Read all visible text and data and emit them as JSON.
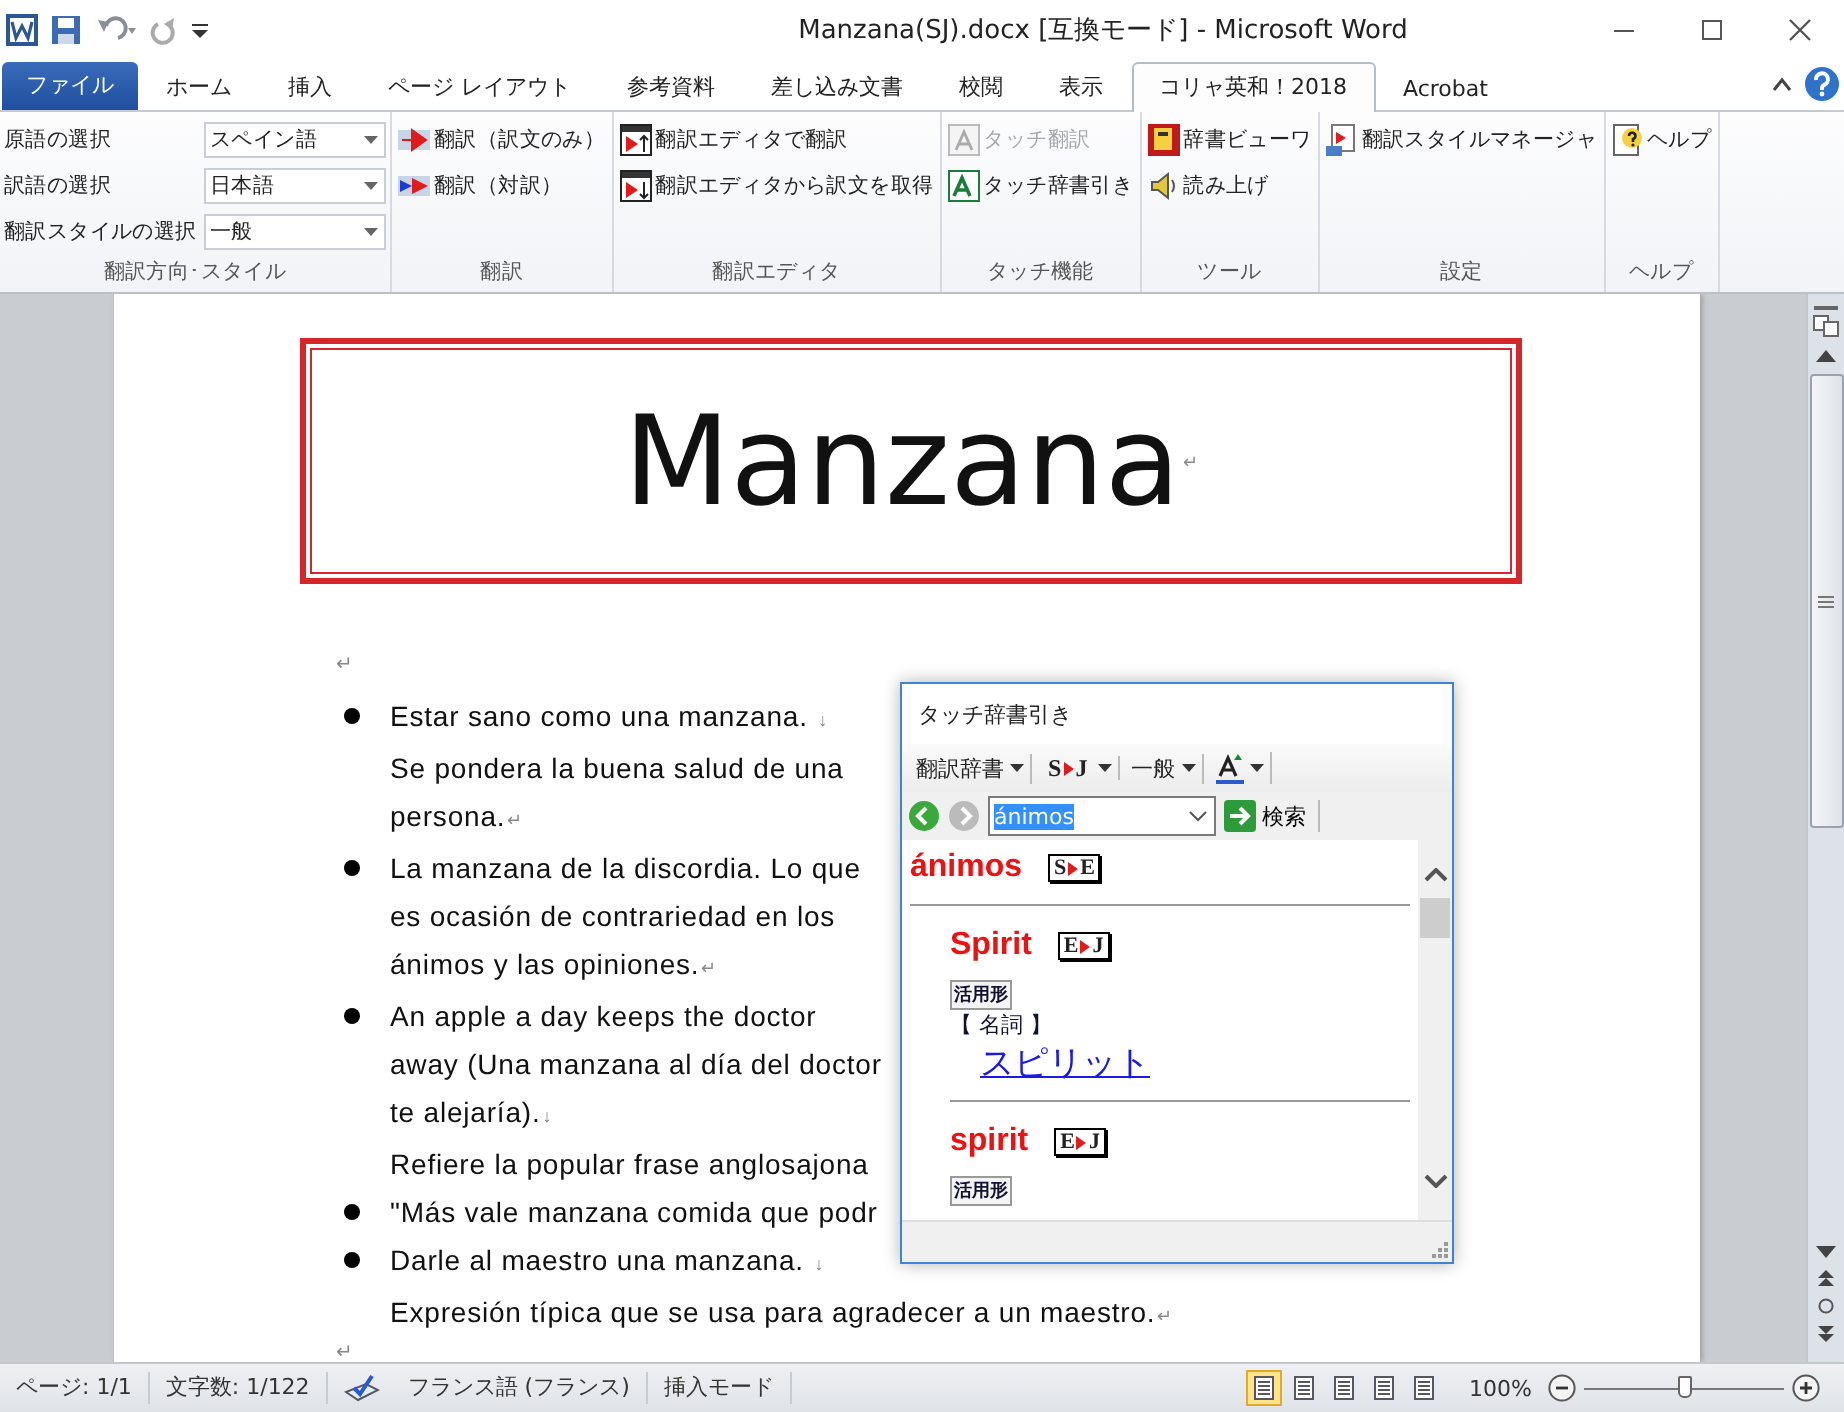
{
  "window": {
    "title": "Manzana(SJ).docx [互換モード] - Microsoft Word"
  },
  "tabs": [
    {
      "label": "ファイル",
      "kind": "file",
      "selected": false
    },
    {
      "label": "ホーム",
      "kind": "tab",
      "selected": false
    },
    {
      "label": "挿入",
      "kind": "tab",
      "selected": false
    },
    {
      "label": "ページ レイアウト",
      "kind": "tab",
      "selected": false
    },
    {
      "label": "参考資料",
      "kind": "tab",
      "selected": false
    },
    {
      "label": "差し込み文書",
      "kind": "tab",
      "selected": false
    },
    {
      "label": "校閲",
      "kind": "tab",
      "selected": false
    },
    {
      "label": "表示",
      "kind": "tab",
      "selected": false
    },
    {
      "label": "コリャ英和！2018",
      "kind": "tab",
      "selected": true
    },
    {
      "label": "Acrobat",
      "kind": "tab",
      "selected": false
    }
  ],
  "ribbon": {
    "groups": [
      {
        "label": "翻訳方向･スタイル",
        "kind": "selectors",
        "rows": [
          {
            "label": "原語の選択",
            "value": "スペイン語"
          },
          {
            "label": "訳語の選択",
            "value": "日本語"
          },
          {
            "label": "翻訳スタイルの選択",
            "value": "一般"
          }
        ]
      },
      {
        "label": "翻訳",
        "kind": "buttons",
        "buttons": [
          {
            "label": "翻訳（訳文のみ）",
            "disabled": false
          },
          {
            "label": "翻訳（対訳）",
            "disabled": false
          }
        ]
      },
      {
        "label": "翻訳エディタ",
        "kind": "buttons",
        "buttons": [
          {
            "label": "翻訳エディタで翻訳",
            "disabled": false
          },
          {
            "label": "翻訳エディタから訳文を取得",
            "disabled": false
          }
        ]
      },
      {
        "label": "タッチ機能",
        "kind": "buttons",
        "buttons": [
          {
            "label": "タッチ翻訳",
            "disabled": true
          },
          {
            "label": "タッチ辞書引き",
            "disabled": false
          }
        ]
      },
      {
        "label": "ツール",
        "kind": "buttons",
        "buttons": [
          {
            "label": "辞書ビューワ",
            "disabled": false
          },
          {
            "label": "読み上げ",
            "disabled": false
          }
        ]
      },
      {
        "label": "設定",
        "kind": "buttons",
        "buttons": [
          {
            "label": "翻訳スタイルマネージャ",
            "disabled": false
          }
        ]
      },
      {
        "label": "ヘルプ",
        "kind": "buttons",
        "buttons": [
          {
            "label": "ヘルプ",
            "disabled": false
          }
        ]
      }
    ]
  },
  "document": {
    "heading": "Manzana",
    "heading_mark": "↵",
    "paragraph_mark": "↵",
    "bullets": [
      {
        "lines": [
          {
            "text": "Estar sano como una manzana. ",
            "mark": "↓"
          },
          {
            "text": "Se pondera la buena salud de una"
          },
          {
            "text": "persona.",
            "mark": "↵"
          }
        ]
      },
      {
        "lines": [
          {
            "text": "La manzana de la discordia. Lo que"
          },
          {
            "text": "es ocasión de contrariedad en los"
          },
          {
            "text": "ánimos y las opiniones.",
            "mark": "↵"
          }
        ]
      },
      {
        "lines": [
          {
            "text": "An apple a day keeps the doctor"
          },
          {
            "text": "away (Una manzana al día del doctor"
          },
          {
            "text": "te alejaría).",
            "mark": "↓"
          },
          {
            "text": "Refiere la popular frase anglosajona"
          }
        ]
      },
      {
        "lines": [
          {
            "text": "\"Más vale manzana comida que podr"
          }
        ]
      },
      {
        "lines": [
          {
            "text": "Darle al maestro una manzana. ",
            "mark": "↓"
          },
          {
            "text": "Expresión típica que se usa para agradecer a un maestro.",
            "mark": "↵"
          }
        ]
      }
    ],
    "end_mark": "↵"
  },
  "dictionary_popup": {
    "title": "タッチ辞書引き",
    "toolbar": [
      {
        "kind": "menu",
        "label": "翻訳辞書"
      },
      {
        "kind": "direction",
        "from": "S",
        "to": "J"
      },
      {
        "kind": "menu",
        "label": "一般"
      },
      {
        "kind": "icon"
      }
    ],
    "search": {
      "value": "ánimos",
      "button": "検索"
    },
    "headword": {
      "text": "ánimos",
      "from": "S",
      "to": "E"
    },
    "entries": [
      {
        "word": "Spirit",
        "from": "E",
        "to": "J",
        "inflection": "活用形",
        "part_of_speech": "【 名詞 】",
        "translation": "スピリット"
      },
      {
        "word": "spirit",
        "from": "E",
        "to": "J",
        "inflection": "活用形"
      }
    ]
  },
  "status_bar": {
    "page": "ページ: 1/1",
    "words": "文字数: 1/122",
    "language": "フランス語 (フランス)",
    "mode": "挿入モード",
    "views": [
      {
        "selected": true
      },
      {
        "selected": false
      },
      {
        "selected": false
      },
      {
        "selected": false
      },
      {
        "selected": false
      }
    ],
    "zoom": "100%",
    "zoom_slider": {
      "level": 0.5
    }
  }
}
